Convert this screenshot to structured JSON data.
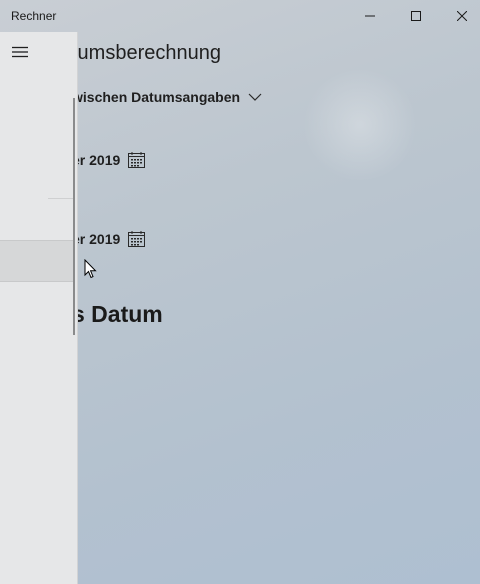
{
  "window": {
    "title": "Rechner",
    "controls": {
      "minimize_icon": "minimize-icon",
      "maximize_icon": "maximize-icon",
      "close_icon": "close-icon"
    }
  },
  "header": {
    "title": "tumsberechnung",
    "mode_label": "wischen Datumsangaben",
    "mode_icon": "chevron-down-icon"
  },
  "dates": {
    "from": "er 2019",
    "to": "er 2019",
    "icon": "calendar-icon"
  },
  "result": {
    "label": "s Datum"
  },
  "nav": {
    "menu_icon": "hamburger-icon"
  },
  "colors": {
    "background": "#bcc6cf",
    "nav_pane": "#e6e7e8",
    "text": "#1f1f1f"
  }
}
